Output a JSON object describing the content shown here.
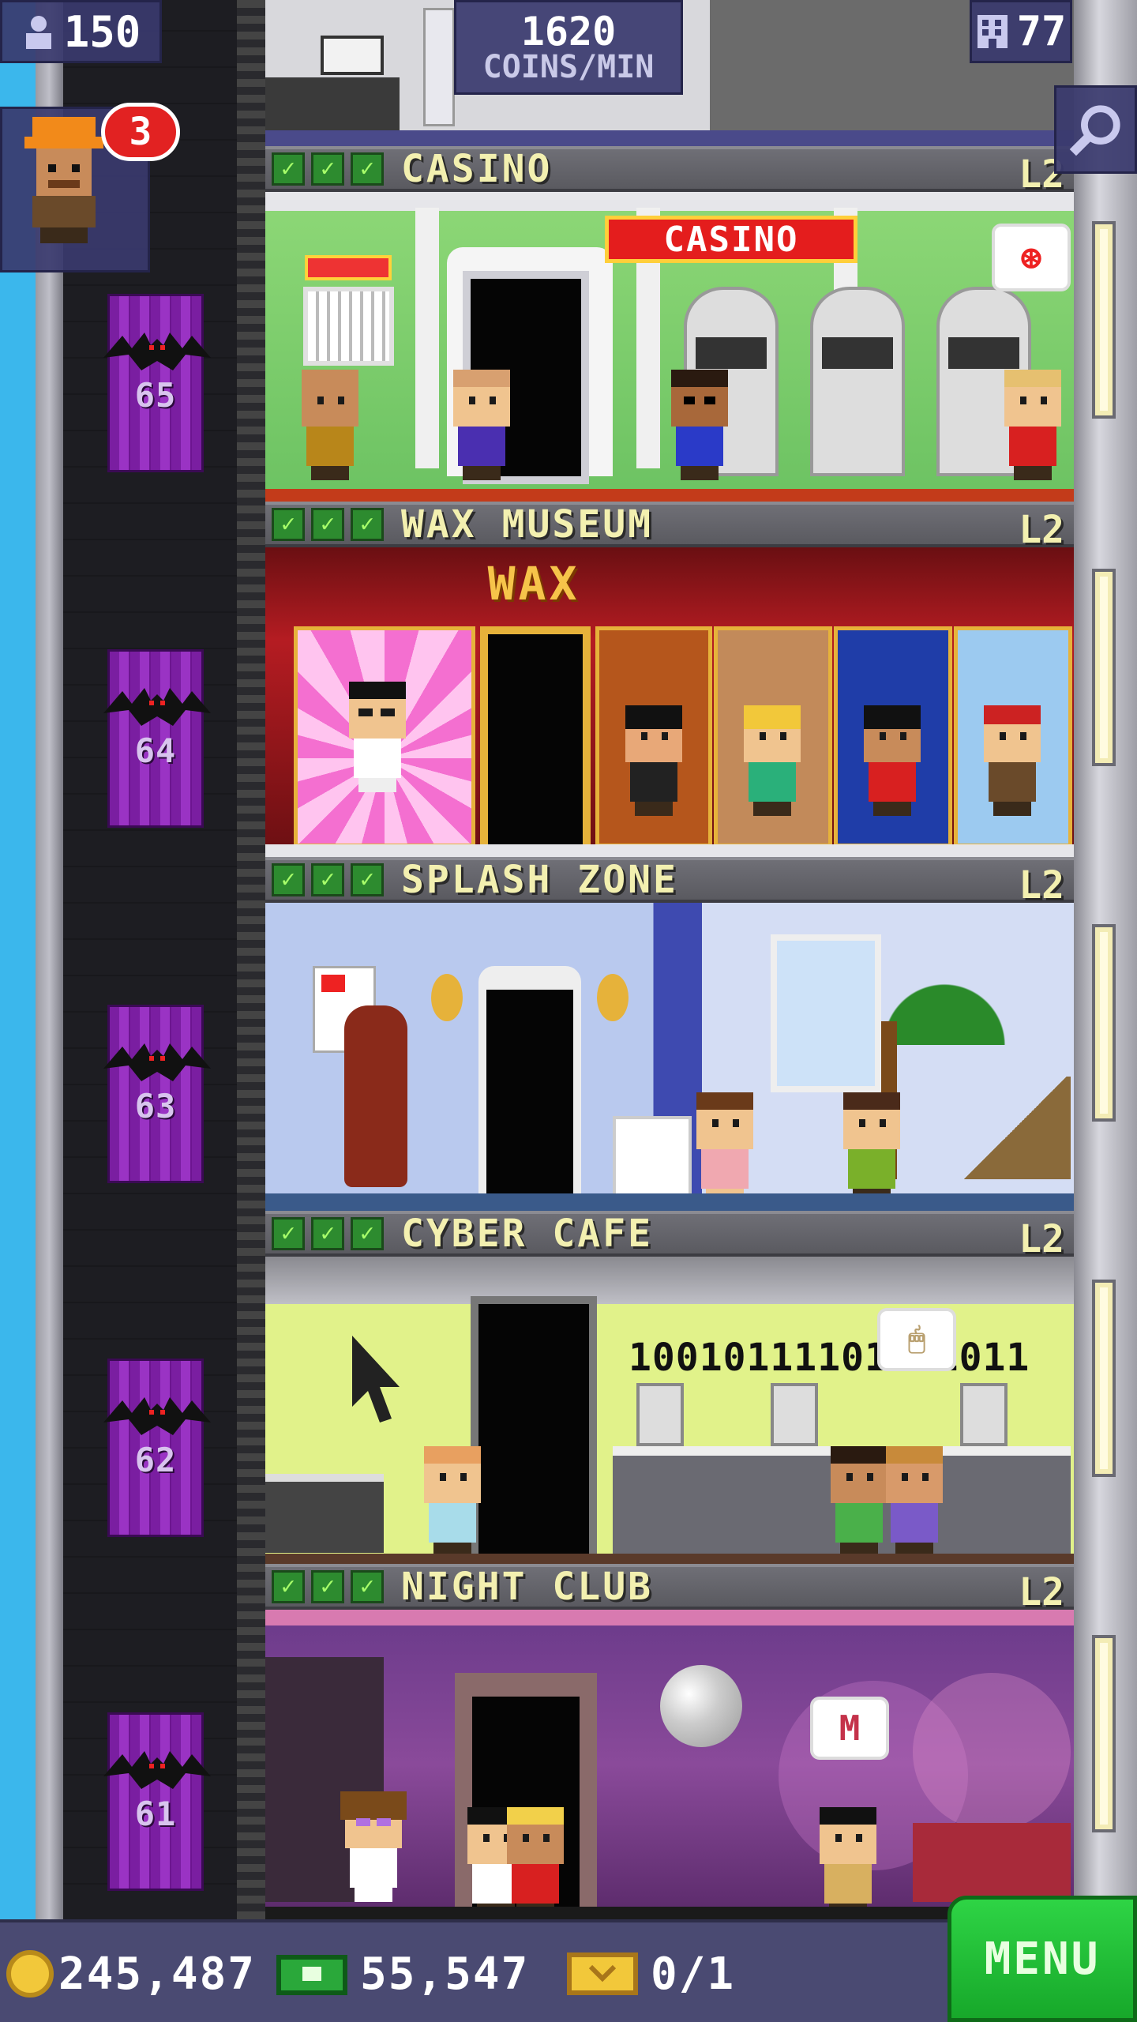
{
  "hud": {
    "population": "150",
    "coins_per_min_value": "1620",
    "coins_per_min_label": "COINS/MIN",
    "floors_count": "77",
    "worker_badge": "3"
  },
  "floors": [
    {
      "name": "CASINO",
      "level": "L2",
      "elevator_floor": "65",
      "sign": "CASINO"
    },
    {
      "name": "WAX MUSEUM",
      "level": "L2",
      "elevator_floor": "64",
      "sign": "WAX"
    },
    {
      "name": "SPLASH ZONE",
      "level": "L2",
      "elevator_floor": "63"
    },
    {
      "name": "CYBER CAFE",
      "level": "L2",
      "elevator_floor": "62",
      "binary_text": "10010111101001011"
    },
    {
      "name": "NIGHT CLUB",
      "level": "L2",
      "elevator_floor": "61",
      "bubble": "M"
    }
  ],
  "bottom_bar": {
    "coins": "245,487",
    "tower_bux": "55,547",
    "tickets": "0/1",
    "menu_label": "MENU"
  },
  "colors": {
    "sky": "#3bb7ec",
    "elevator": "#8a2bb5",
    "banner_text": "#f3f0b0",
    "menu": "#22c23a"
  },
  "icons": [
    "people-icon",
    "floors-icon",
    "search-icon",
    "worker-icon",
    "coin-icon",
    "bux-icon",
    "ticket-icon",
    "check-icon",
    "bat-icon"
  ]
}
